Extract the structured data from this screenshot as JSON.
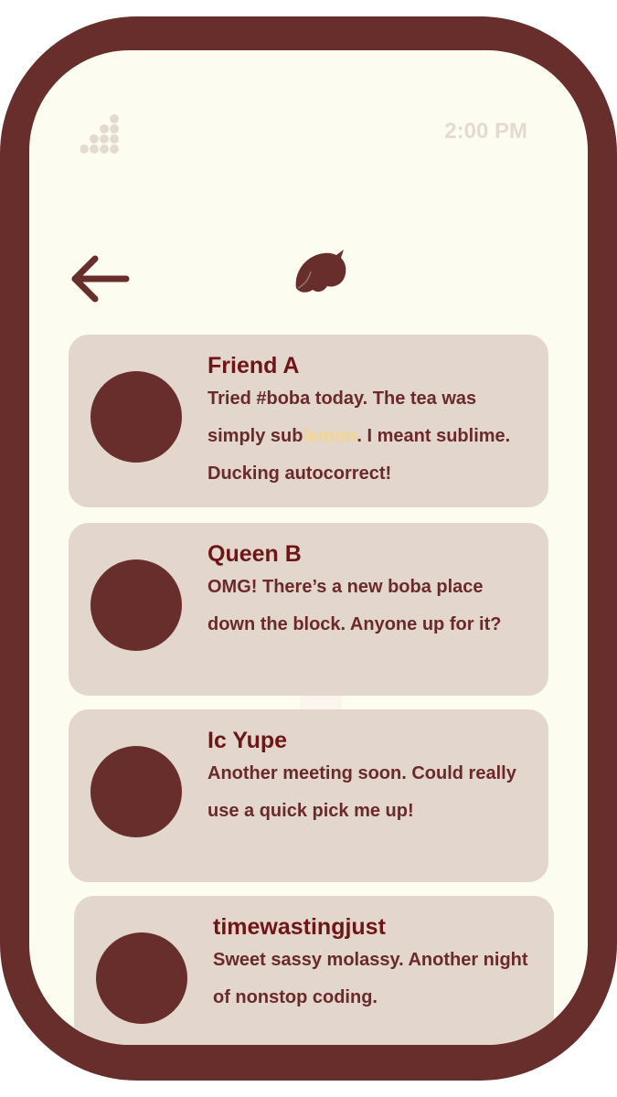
{
  "status_bar": {
    "time": "2:00 PM",
    "signal_icon": "signal-dots-icon"
  },
  "header": {
    "back_icon": "back-arrow-icon",
    "logo_icon": "bird-logo-icon"
  },
  "posts": [
    {
      "name": "Friend A",
      "text_before": "Tried #boba today. The tea was simply sub",
      "text_highlight": "lemon",
      "text_after": ". I meant sublime. Ducking autocorrect!"
    },
    {
      "name": "Queen B",
      "text": "OMG! There’s a new boba place down the block. Anyone up for it?"
    },
    {
      "name": "Ic Yupe",
      "text": "Another meeting soon. Could really use a quick pick me up!"
    },
    {
      "name": "timewastingjust",
      "text": "Sweet sassy molassy. Another night of nonstop coding."
    }
  ],
  "colors": {
    "frame": "#672e2c",
    "screen": "#fdfcf1",
    "card": "#e3d6cd",
    "name_text": "#6e1616",
    "body_text": "#6b2a2a",
    "highlight": "#f3d68e",
    "status_text": "#e4dad0"
  }
}
